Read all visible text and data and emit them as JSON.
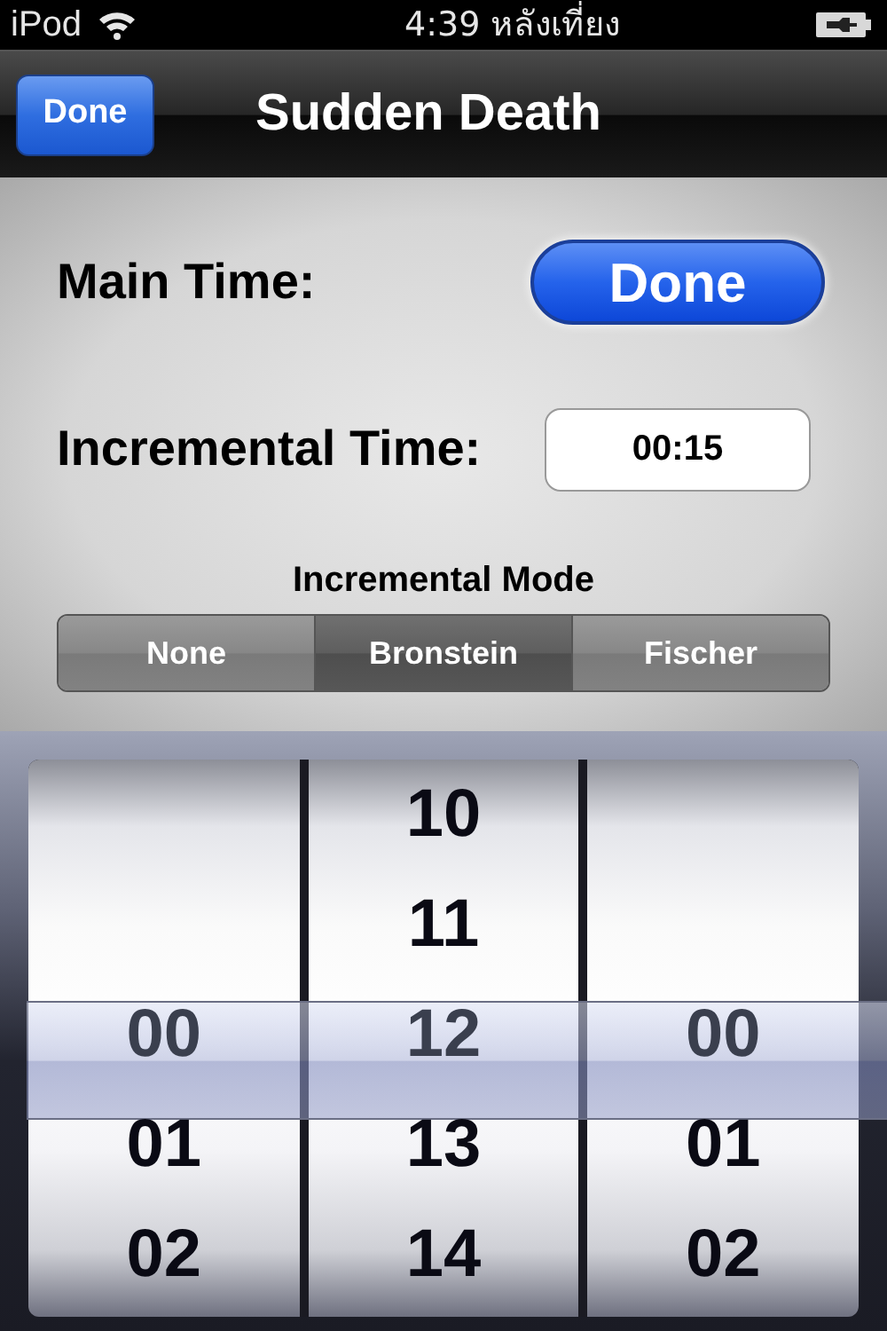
{
  "status_bar": {
    "carrier": "iPod",
    "time": "4:39 หลังเที่ยง"
  },
  "nav_bar": {
    "done_button": "Done",
    "title": "Sudden Death"
  },
  "main_time": {
    "label": "Main Time:",
    "button": "Done"
  },
  "incremental_time": {
    "label": "Incremental Time:",
    "value": "00:15"
  },
  "incremental_mode": {
    "label": "Incremental Mode",
    "segments": [
      {
        "label": "None",
        "selected": false
      },
      {
        "label": "Bronstein",
        "selected": true
      },
      {
        "label": "Fischer",
        "selected": false
      }
    ]
  },
  "picker": {
    "columns": [
      {
        "items": [
          {
            "value": "00",
            "selected": true
          },
          {
            "value": "01",
            "selected": false
          },
          {
            "value": "02",
            "selected": false
          }
        ]
      },
      {
        "items": [
          {
            "value": "10",
            "selected": false
          },
          {
            "value": "11",
            "selected": false
          },
          {
            "value": "12",
            "selected": true
          },
          {
            "value": "13",
            "selected": false
          },
          {
            "value": "14",
            "selected": false
          }
        ]
      },
      {
        "items": [
          {
            "value": "00",
            "selected": true
          },
          {
            "value": "01",
            "selected": false
          },
          {
            "value": "02",
            "selected": false
          }
        ]
      }
    ]
  }
}
